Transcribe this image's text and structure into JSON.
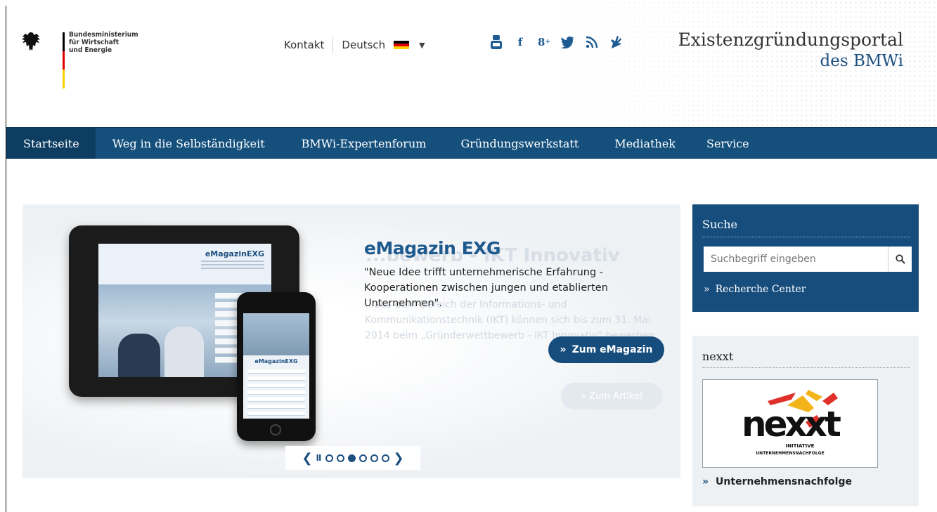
{
  "header": {
    "ministry_lines": [
      "Bundesministerium",
      "für Wirtschaft",
      "und Energie"
    ],
    "topnav": {
      "contact": "Kontakt",
      "language": "Deutsch",
      "caret": "▼"
    },
    "social_icons": [
      "youtube-icon",
      "facebook-icon",
      "google-plus-icon",
      "twitter-icon",
      "rss-icon",
      "sign-language-icon"
    ],
    "portal_title": "Existenzgründungsportal",
    "portal_subtitle": "des BMWi"
  },
  "mainnav": {
    "items": [
      "Startseite",
      "Weg in die Selbständigkeit",
      "BMWi-Expertenforum",
      "Gründungswerkstatt",
      "Mediathek",
      "Service"
    ],
    "active_index": 0
  },
  "slider": {
    "title": "eMagazin EXG",
    "description": "\"Neue Idee trifft unternehmerische Erfahrung - Kooperationen zwischen jungen und etablierten Unternehmen\".",
    "button_label": "Zum eMagazin",
    "button_chevron": "»",
    "ghost_title": "...bewerb - IKT Innovativ",
    "ghost_text": "...aus dem Bereich der Informations- und Kommunikationstechnik (IKT) können sich bis zum 31. Mai 2014 beim „Gründerwettbewerb - IKT Innovativ\" bewerben.",
    "ghost_button": "» Zum Artikel",
    "device_title_tablet": "eMagazinEXG",
    "device_title_phone": "eMagazinEXG",
    "pager": {
      "prev": "❮",
      "pause": "II",
      "next": "❯",
      "dots": 6,
      "active_dot": 2
    }
  },
  "search": {
    "heading": "Suche",
    "placeholder": "Suchbegriff eingeben",
    "link_chevron": "»",
    "link_label": "Recherche Center"
  },
  "nexxt": {
    "heading": "nexxt",
    "logo_word": "nexxt",
    "logo_sub1": "INITIATIVE",
    "logo_sub2": "UNTERNEHMENSNACHFOLGE",
    "link_chevron": "»",
    "link_label": "Unternehmensnachfolge"
  },
  "colors": {
    "brand_blue": "#174d7c",
    "nav_blue": "#15507d",
    "flag": [
      "#000000",
      "#dd0000",
      "#ffce00"
    ]
  }
}
